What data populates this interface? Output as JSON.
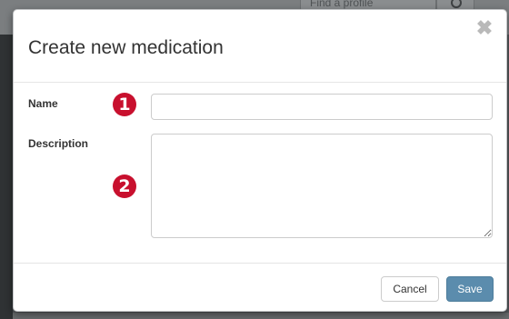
{
  "background": {
    "search_placeholder": "Find a profile"
  },
  "modal": {
    "title": "Create new medication",
    "close_glyph": "✖",
    "fields": {
      "name": {
        "label": "Name",
        "value": "",
        "placeholder": ""
      },
      "description": {
        "label": "Description",
        "value": "",
        "placeholder": ""
      }
    },
    "markers": [
      "1",
      "2"
    ],
    "footer": {
      "cancel_label": "Cancel",
      "save_label": "Save"
    }
  },
  "colors": {
    "marker": "#c8102e",
    "primary_button": "#5b8cad"
  },
  "icons": {
    "close": "close-icon",
    "search": "search-icon"
  }
}
